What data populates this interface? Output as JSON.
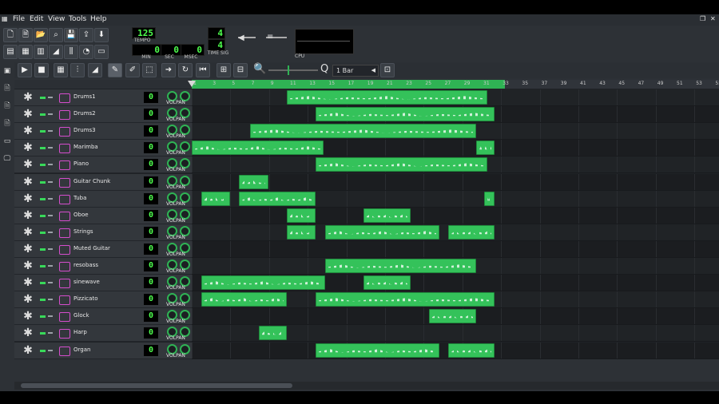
{
  "menu": {
    "items": [
      "File",
      "Edit",
      "View",
      "Tools",
      "Help"
    ]
  },
  "lcd": {
    "tempo": "125",
    "tempo_label": "TEMPO",
    "min": "0",
    "min_label": "MIN",
    "sec": "0",
    "sec_label": "SEC",
    "msec": "0",
    "msec_label": "MSEC",
    "timesig_num": "4",
    "timesig_den": "4",
    "timesig_label": "TIME SIG",
    "cpu_label": "CPU"
  },
  "song_toolbar": {
    "zoom_value": "1 Bar"
  },
  "ruler": {
    "ticks": [
      "1",
      "3",
      "5",
      "7",
      "9",
      "11",
      "13",
      "15",
      "17",
      "19",
      "21",
      "23",
      "25",
      "27",
      "29",
      "31",
      "33",
      "35",
      "37",
      "39",
      "41",
      "43",
      "45",
      "47",
      "49",
      "51",
      "53",
      "55"
    ]
  },
  "track_controls": {
    "vol_label": "VOL",
    "pan_label": "PAN"
  },
  "tracks": [
    {
      "name": "Drums1",
      "value": "0",
      "clips": [
        [
          0.18,
          0.56
        ]
      ]
    },
    {
      "name": "Drums2",
      "value": "0",
      "clips": [
        [
          0.235,
          0.575
        ]
      ]
    },
    {
      "name": "Drums3",
      "value": "0",
      "clips": [
        [
          0.11,
          0.54
        ]
      ]
    },
    {
      "name": "Marimba",
      "value": "0",
      "clips": [
        [
          0.0,
          0.25
        ],
        [
          0.54,
          0.575
        ]
      ]
    },
    {
      "name": "Piano",
      "value": "0",
      "clips": [
        [
          0.235,
          0.56
        ]
      ]
    },
    {
      "name": "Guitar Chunk",
      "value": "0",
      "clips": [
        [
          0.09,
          0.145
        ]
      ]
    },
    {
      "name": "Tuba",
      "value": "0",
      "clips": [
        [
          0.018,
          0.073
        ],
        [
          0.09,
          0.235
        ],
        [
          0.555,
          0.575
        ]
      ]
    },
    {
      "name": "Oboe",
      "value": "0",
      "clips": [
        [
          0.18,
          0.235
        ],
        [
          0.325,
          0.415
        ]
      ]
    },
    {
      "name": "Strings",
      "value": "0",
      "clips": [
        [
          0.18,
          0.235
        ],
        [
          0.253,
          0.47
        ],
        [
          0.487,
          0.575
        ]
      ]
    },
    {
      "name": "Muted Guitar",
      "value": "0",
      "clips": []
    },
    {
      "name": "resobass",
      "value": "0",
      "clips": [
        [
          0.253,
          0.54
        ]
      ]
    },
    {
      "name": "sinewave",
      "value": "0",
      "clips": [
        [
          0.018,
          0.253
        ],
        [
          0.325,
          0.415
        ]
      ]
    },
    {
      "name": "Pizzicato",
      "value": "0",
      "clips": [
        [
          0.018,
          0.18
        ],
        [
          0.235,
          0.575
        ]
      ]
    },
    {
      "name": "Glock",
      "value": "0",
      "clips": [
        [
          0.45,
          0.54
        ]
      ]
    },
    {
      "name": "Harp",
      "value": "0",
      "clips": [
        [
          0.127,
          0.18
        ]
      ]
    },
    {
      "name": "Organ",
      "value": "0",
      "clips": [
        [
          0.235,
          0.47
        ],
        [
          0.487,
          0.575
        ]
      ]
    }
  ]
}
